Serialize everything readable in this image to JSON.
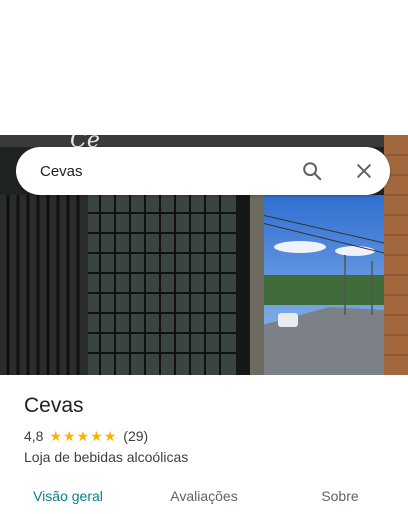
{
  "search": {
    "value": "Cevas",
    "placeholder": ""
  },
  "place": {
    "name": "Cevas",
    "rating": "4,8",
    "stars": [
      "★",
      "★",
      "★",
      "★",
      "★"
    ],
    "review_count": "(29)",
    "category": "Loja de bebidas alcoólicas"
  },
  "tabs": [
    {
      "label": "Visão geral",
      "active": true
    },
    {
      "label": "Avaliações",
      "active": false
    },
    {
      "label": "Sobre",
      "active": false
    }
  ],
  "colors": {
    "accent": "#0b7d8c",
    "star": "#f5b400"
  },
  "icons": {
    "search": "search-icon",
    "close": "close-icon"
  }
}
